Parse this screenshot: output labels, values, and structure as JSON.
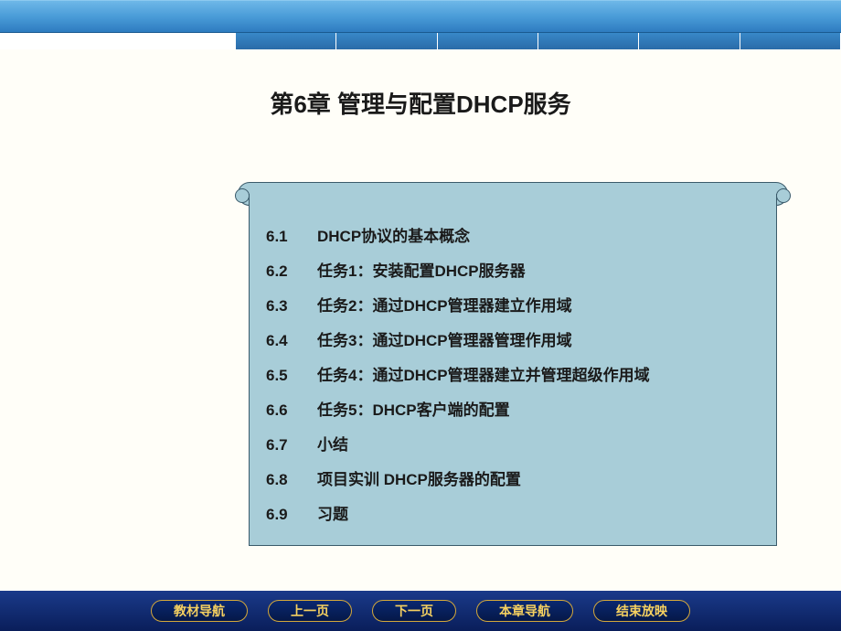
{
  "chapter": {
    "title": "第6章  管理与配置DHCP服务"
  },
  "toc": [
    {
      "num": "6.1",
      "text": "DHCP协议的基本概念"
    },
    {
      "num": "6.2",
      "text": "任务1：安装配置DHCP服务器"
    },
    {
      "num": "6.3",
      "text": "任务2：通过DHCP管理器建立作用域"
    },
    {
      "num": "6.4",
      "text": "任务3：通过DHCP管理器管理作用域"
    },
    {
      "num": "6.5",
      "text": "任务4：通过DHCP管理器建立并管理超级作用域"
    },
    {
      "num": "6.6",
      "text": "任务5：DHCP客户端的配置"
    },
    {
      "num": "6.7",
      "text": "小结"
    },
    {
      "num": "6.8",
      "text": "项目实训  DHCP服务器的配置"
    },
    {
      "num": "6.9",
      "text": "习题"
    }
  ],
  "nav": {
    "textbook": "教材导航",
    "prev": "上一页",
    "next": "下一页",
    "chapter_nav": "本章导航",
    "end": "结束放映"
  }
}
